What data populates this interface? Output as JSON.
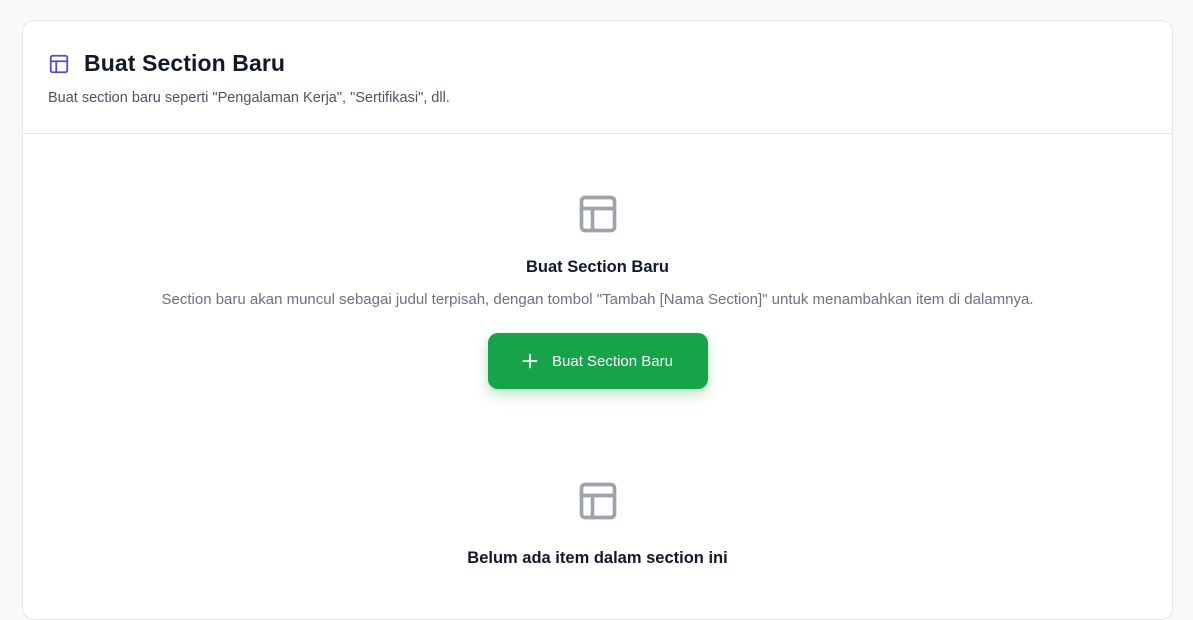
{
  "header": {
    "title": "Buat Section Baru",
    "subtitle": "Buat section baru seperti \"Pengalaman Kerja\", \"Sertifikasi\", dll.",
    "icon": "layout-icon"
  },
  "create_section": {
    "icon": "layout-icon",
    "title": "Buat Section Baru",
    "description": "Section baru akan muncul sebagai judul terpisah, dengan tombol \"Tambah [Nama Section]\" untuk menambahkan item di dalamnya.",
    "button_label": "Buat Section Baru",
    "button_icon": "plus-icon"
  },
  "empty_items": {
    "icon": "layout-icon",
    "title": "Belum ada item dalam section ini"
  },
  "colors": {
    "accent_icon": "#5b4bc4",
    "primary_button": "#16a34a",
    "muted_icon": "#9ca3af"
  }
}
